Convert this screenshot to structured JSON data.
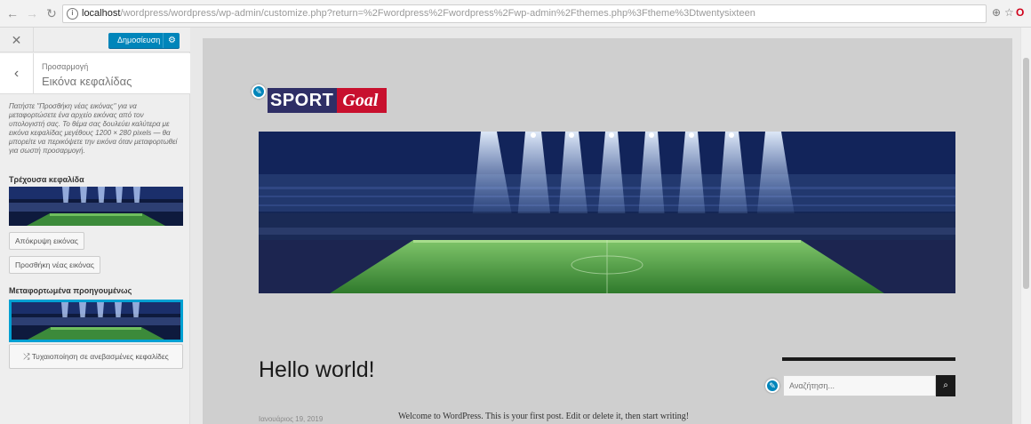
{
  "browser": {
    "url_host": "localhost",
    "url_path": "/wordpress/wordpress/wp-admin/customize.php?return=%2Fwordpress%2Fwordpress%2Fwp-admin%2Fthemes.php%3Ftheme%3Dtwentysixteen"
  },
  "customizer": {
    "publish_label": "Δημοσίευση",
    "breadcrumb": "Προσαρμογή",
    "section_title": "Εικόνα κεφαλίδας",
    "description": "Πατήστε \"Προσθήκη νέας εικόνας\" για να μεταφορτώσετε ένα αρχείο εικόνας από τον υπολογιστή σας. Το θέμα σας δουλεύει καλύτερα με εικόνα κεφαλίδας μεγέθους 1200 × 280 pixels — θα μπορείτε να περικόψετε την εικόνα όταν μεταφορτωθεί για σωστή προσαρμογή.",
    "current_header_label": "Τρέχουσα κεφαλίδα",
    "hide_image_label": "Απόκρυψη εικόνας",
    "add_image_label": "Προσθήκη νέας εικόνας",
    "previously_uploaded_label": "Μεταφορτωμένα προηγουμένως",
    "randomize_label": "Τυχαιοποίηση σε ανεβασμένες κεφαλίδες"
  },
  "site": {
    "logo_part1": "SPORT",
    "logo_part2": "Goal",
    "post_title": "Hello world!",
    "post_date": "Ιανουάριος 19, 2019",
    "post_excerpt": "Welcome to WordPress. This is your first post. Edit or delete it, then start writing!",
    "search_placeholder": "Αναζήτηση..."
  },
  "colors": {
    "publish": "#0085ba",
    "logo_navy": "#2f2f66",
    "logo_red": "#c8102e",
    "selection": "#00a0d2"
  },
  "icons": {
    "close": "close-icon",
    "back": "chevron-left-icon",
    "gear": "gear-icon",
    "shuffle": "shuffle-icon",
    "edit": "pencil-icon",
    "search": "search-icon"
  }
}
